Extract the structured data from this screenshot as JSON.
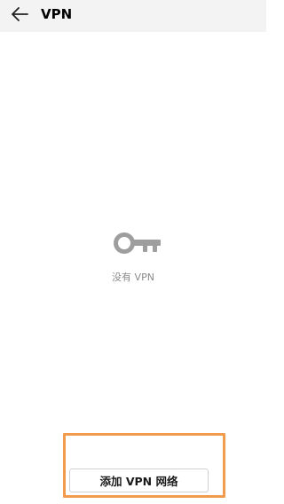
{
  "header": {
    "back_icon": "arrow-left-icon",
    "title": "VPN"
  },
  "empty_state": {
    "icon": "key-icon",
    "message": "没有 VPN"
  },
  "add_button": {
    "label": "添加 VPN 网络"
  },
  "colors": {
    "header_bg": "#f3f3f3",
    "icon_gray": "#9e9e9e",
    "highlight_orange": "#f29b4c",
    "button_border": "#d0d0d0"
  }
}
